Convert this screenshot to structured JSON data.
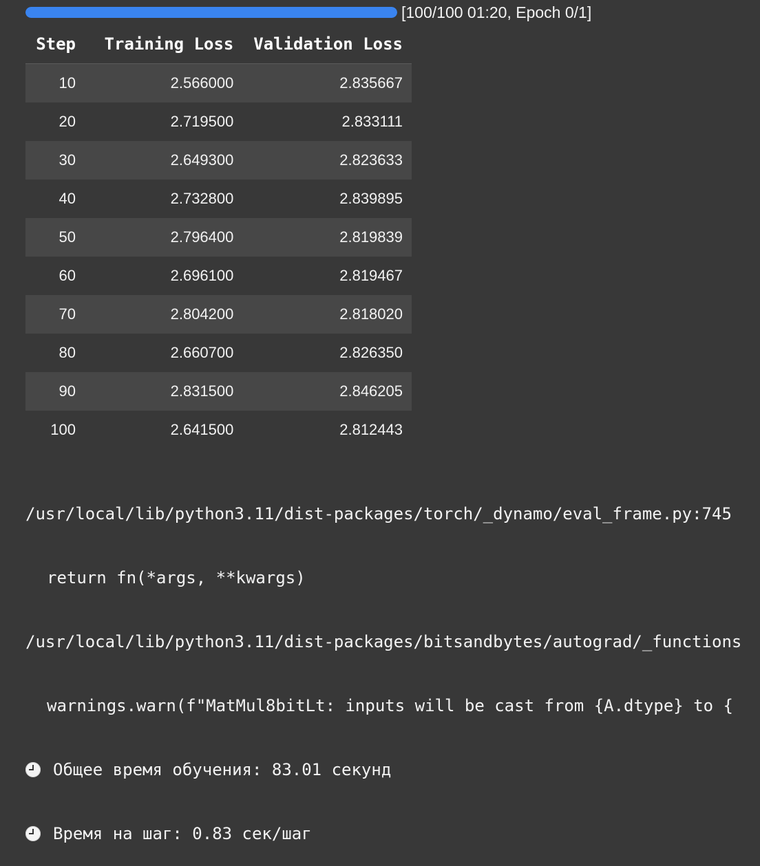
{
  "progress": {
    "fraction": 1.0,
    "text": "[100/100 01:20, Epoch 0/1]",
    "color": "#3a84f0"
  },
  "table": {
    "headers": [
      "Step",
      "Training Loss",
      "Validation Loss"
    ],
    "rows": [
      [
        "10",
        "2.566000",
        "2.835667"
      ],
      [
        "20",
        "2.719500",
        "2.833111"
      ],
      [
        "30",
        "2.649300",
        "2.823633"
      ],
      [
        "40",
        "2.732800",
        "2.839895"
      ],
      [
        "50",
        "2.796400",
        "2.819839"
      ],
      [
        "60",
        "2.696100",
        "2.819467"
      ],
      [
        "70",
        "2.804200",
        "2.818020"
      ],
      [
        "80",
        "2.660700",
        "2.826350"
      ],
      [
        "90",
        "2.831500",
        "2.846205"
      ],
      [
        "100",
        "2.641500",
        "2.812443"
      ]
    ]
  },
  "console": {
    "lines": [
      "/usr/local/lib/python3.11/dist-packages/torch/_dynamo/eval_frame.py:745",
      "return fn(*args, **kwargs)",
      "/usr/local/lib/python3.11/dist-packages/bitsandbytes/autograd/_functions",
      "warnings.warn(f\"MatMul8bitLt: inputs will be cast from {A.dtype} to {",
      "Общее время обучения: 83.01 секунд",
      "Время на шаг: 0.83 сек/шаг"
    ],
    "line_icons": [
      "",
      "",
      "",
      "",
      "clock-icon",
      "clock-icon"
    ]
  }
}
